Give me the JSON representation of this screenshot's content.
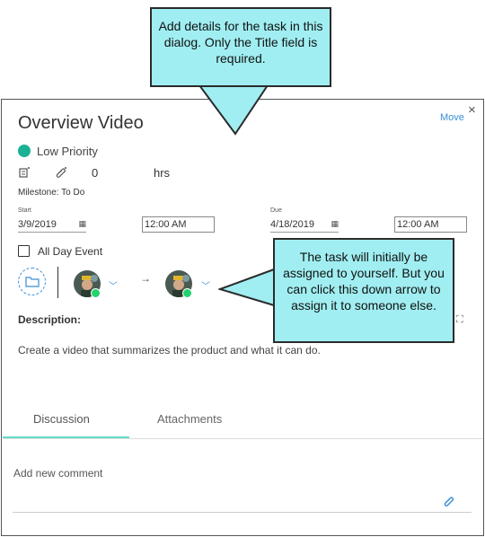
{
  "dialog": {
    "title": "Overview Video",
    "move_label": "Move",
    "close_glyph": "×",
    "priority": {
      "label": "Low Priority",
      "color": "#1bb197"
    },
    "counts": {
      "value": "0",
      "hours_label": "hrs"
    },
    "milestone": "Milestone: To Do",
    "start": {
      "label": "Start",
      "date": "3/9/2019",
      "time": "12:00 AM"
    },
    "due": {
      "label": "Due",
      "date": "4/18/2019",
      "time": "12:00 AM"
    },
    "all_day_label": "All Day Event",
    "arrow_glyph": "→",
    "description": {
      "label": "Description:",
      "text": "Create a video that summarizes the product and what it can do."
    },
    "tabs": [
      {
        "label": "Discussion",
        "active": true
      },
      {
        "label": "Attachments",
        "active": false
      }
    ],
    "comment_placeholder": "Add new comment",
    "accent_color": "#3a8fd6",
    "online_color": "#21d36e"
  },
  "callouts": {
    "top": "Add details for the task in this dialog. Only the Title field is required.",
    "right": "The task will initially be assigned to yourself. But you can click this down arrow to assign it to someone else."
  }
}
